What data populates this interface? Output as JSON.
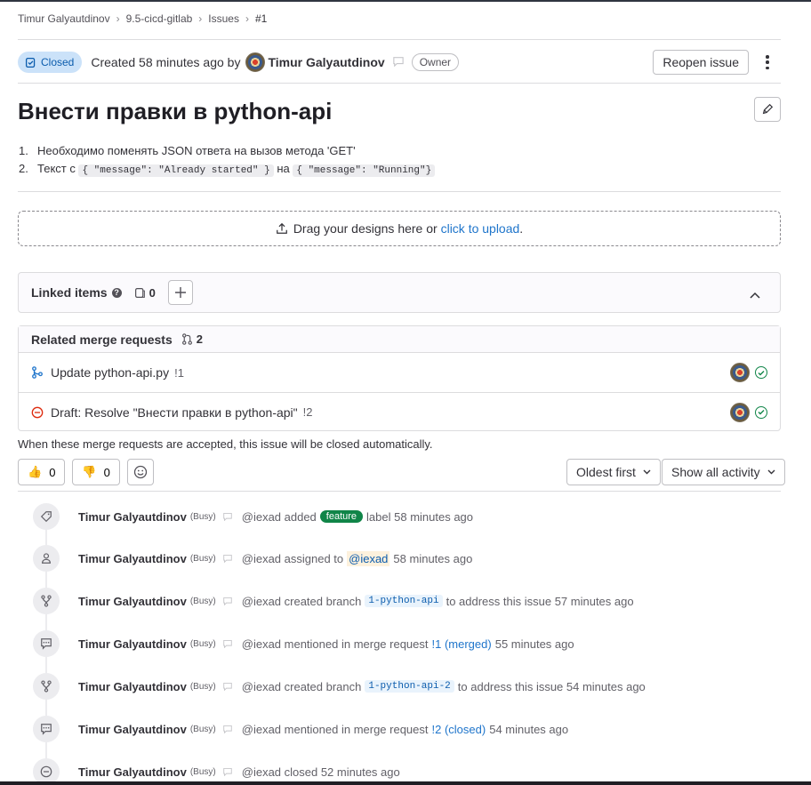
{
  "breadcrumb": [
    "Timur Galyautdinov",
    "9.5-cicd-gitlab",
    "Issues",
    "#1"
  ],
  "header": {
    "status": "Closed",
    "created_text": "Created 58 minutes ago by",
    "author": "Timur Galyautdinov",
    "role": "Owner",
    "reopen_label": "Reopen issue"
  },
  "issue": {
    "title": "Внести правки в python-api",
    "items": [
      {
        "num": "1.",
        "text": "Необходимо поменять JSON ответа на вызов метода 'GET'"
      },
      {
        "num": "2.",
        "pre": "Текст с",
        "code1": "{ \"message\": \"Already started\" }",
        "mid": "на",
        "code2": "{ \"message\": \"Running\"}"
      }
    ]
  },
  "upload": {
    "text": "Drag your designs here or",
    "link": "click to upload",
    "end": "."
  },
  "linked_items": {
    "label": "Linked items",
    "count": "0"
  },
  "related_mrs": {
    "label": "Related merge requests",
    "count": "2",
    "items": [
      {
        "title": "Update python-api.py",
        "ref": "!1"
      },
      {
        "title": "Draft: Resolve \"Внести правки в python-api\"",
        "ref": "!2"
      }
    ]
  },
  "autoclose_note": "When these merge requests are accepted, this issue will be closed automatically.",
  "awards": {
    "thumbsup": "0",
    "thumbsdown": "0"
  },
  "sort": {
    "order": "Oldest first",
    "filter": "Show all activity"
  },
  "activity": [
    {
      "icon": "label-icon",
      "author": "Timur Galyautdinov",
      "busy": "(Busy)",
      "pre": "@iexad added",
      "pill": "feature",
      "post": "label 58 minutes ago"
    },
    {
      "icon": "user-icon",
      "author": "Timur Galyautdinov",
      "busy": "(Busy)",
      "pre": "@iexad assigned to",
      "pill": "@iexad",
      "post": "58 minutes ago"
    },
    {
      "icon": "branch-icon",
      "author": "Timur Galyautdinov",
      "busy": "(Busy)",
      "pre": "@iexad created branch",
      "pill": "1-python-api",
      "post": "to address this issue 57 minutes ago"
    },
    {
      "icon": "comment-icon",
      "author": "Timur Galyautdinov",
      "busy": "(Busy)",
      "pre": "@iexad mentioned in merge request",
      "pill": "!1 (merged)",
      "post": "55 minutes ago"
    },
    {
      "icon": "branch-icon",
      "author": "Timur Galyautdinov",
      "busy": "(Busy)",
      "pre": "@iexad created branch",
      "pill": "1-python-api-2",
      "post": "to address this issue 54 minutes ago"
    },
    {
      "icon": "comment-icon",
      "author": "Timur Galyautdinov",
      "busy": "(Busy)",
      "pre": "@iexad mentioned in merge request",
      "pill": "!2 (closed)",
      "post": "54 minutes ago"
    },
    {
      "icon": "closed-icon",
      "author": "Timur Galyautdinov",
      "busy": "(Busy)",
      "pre": "@iexad closed 52 minutes ago"
    }
  ]
}
